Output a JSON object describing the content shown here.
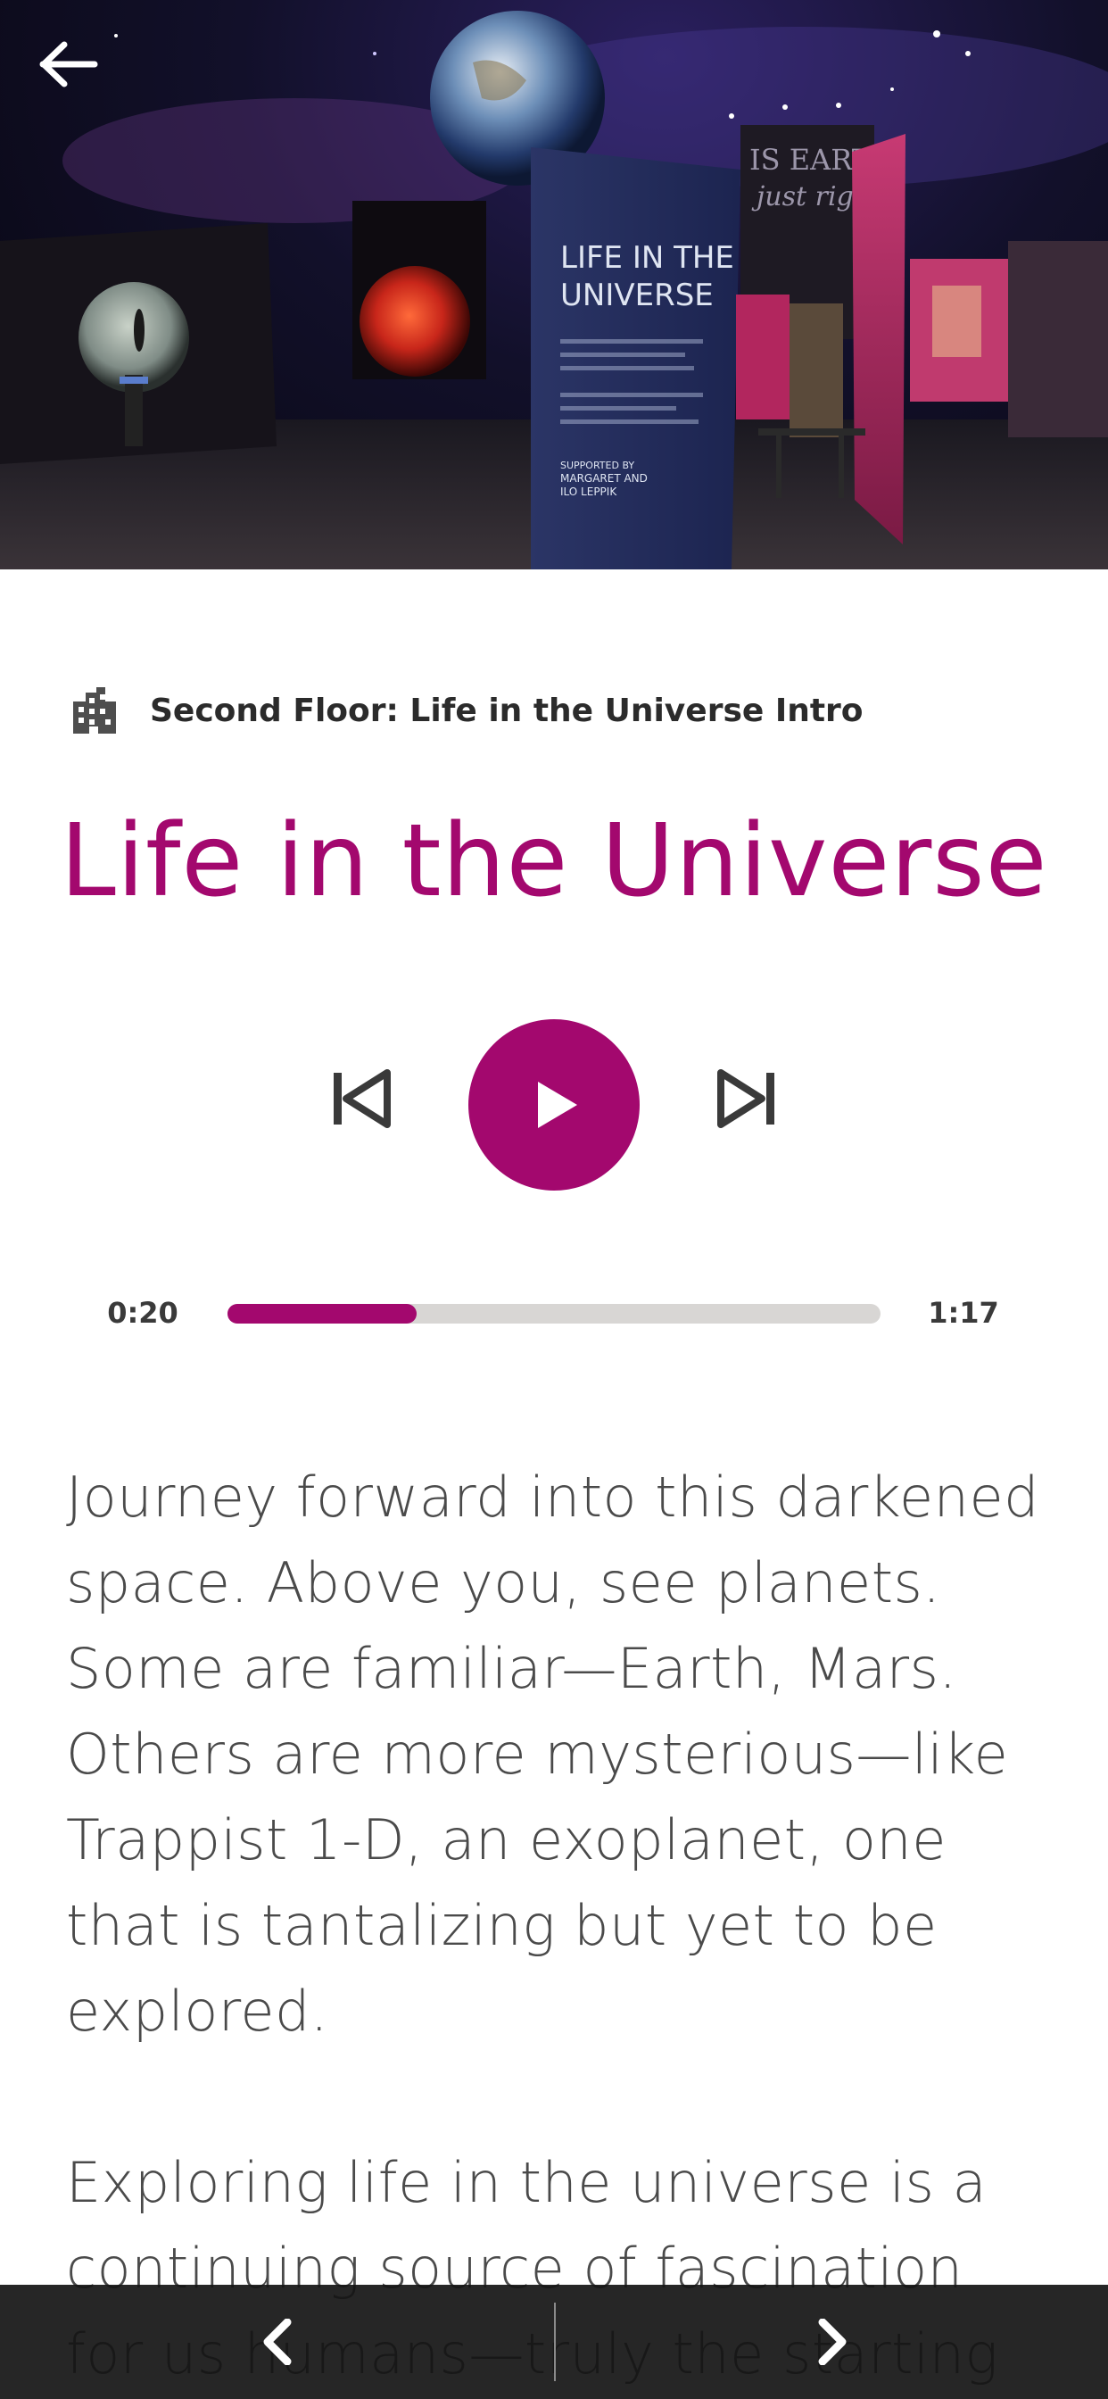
{
  "navigation": {
    "back_icon": "arrow-left-icon"
  },
  "hero": {
    "description": "Exhibit hall photo",
    "panel_title": "LIFE IN THE UNIVERSE",
    "panel_supporters_heading": "SUPPORTED BY",
    "panel_supporters": "MARGARET AND ILO LEPPIK",
    "wall_text": "IS EARTH just right?"
  },
  "location": {
    "icon": "building-icon",
    "label": "Second Floor: Life in the Universe Intro"
  },
  "track": {
    "title": "Life in the Universe"
  },
  "player": {
    "prev_icon": "skip-previous-icon",
    "play_icon": "play-icon",
    "next_icon": "skip-next-icon",
    "elapsed": "0:20",
    "duration": "1:17",
    "progress_fraction": 0.29
  },
  "description": {
    "paragraphs": [
      "Journey forward into this darkened space. Above you, see planets. Some are familiar—Earth, Mars. Others are more mysterious—like Trappist 1-D, an exoplanet, one that is tantalizing but yet to be explored.",
      "Exploring life in the universe is a continuing source of fascination for us humans—truly the starting"
    ]
  },
  "bottom_bar": {
    "prev_icon": "chevron-left-icon",
    "next_icon": "chevron-right-icon"
  },
  "colors": {
    "accent": "#a3086e",
    "track": "#d8d6d4",
    "text": "#4a4a4a",
    "bottom_bar": "#141414"
  }
}
